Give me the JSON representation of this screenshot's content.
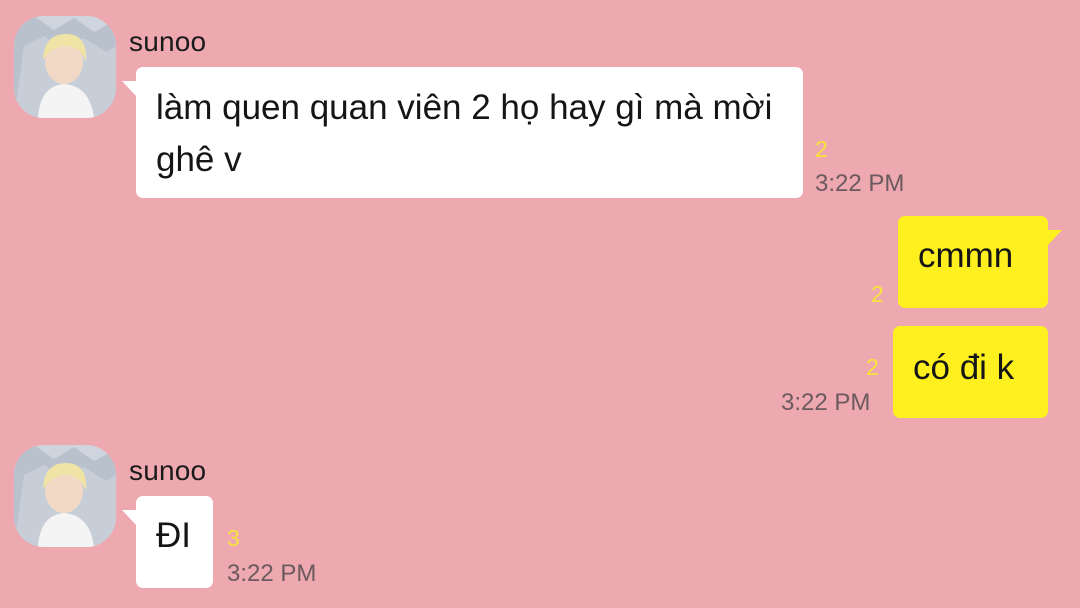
{
  "messages": [
    {
      "sender": "sunoo",
      "text": "làm quen quan viên 2 họ hay gì mà mời ghê v",
      "unread": "2",
      "time": "3:22 PM"
    },
    {
      "text": "cmmn",
      "unread": "2"
    },
    {
      "text": "có đi k",
      "unread": "2",
      "time": "3:22 PM"
    },
    {
      "sender": "sunoo",
      "text": "ĐI",
      "unread": "3",
      "time": "3:22 PM"
    }
  ],
  "colors": {
    "background": "#EDA8B0",
    "incoming_bubble": "#FFFFFF",
    "outgoing_bubble": "#FEF01E",
    "unread_count": "#F7E33A",
    "timestamp": "#6B5A5E"
  },
  "icons": {
    "avatar": "profile-photo"
  }
}
